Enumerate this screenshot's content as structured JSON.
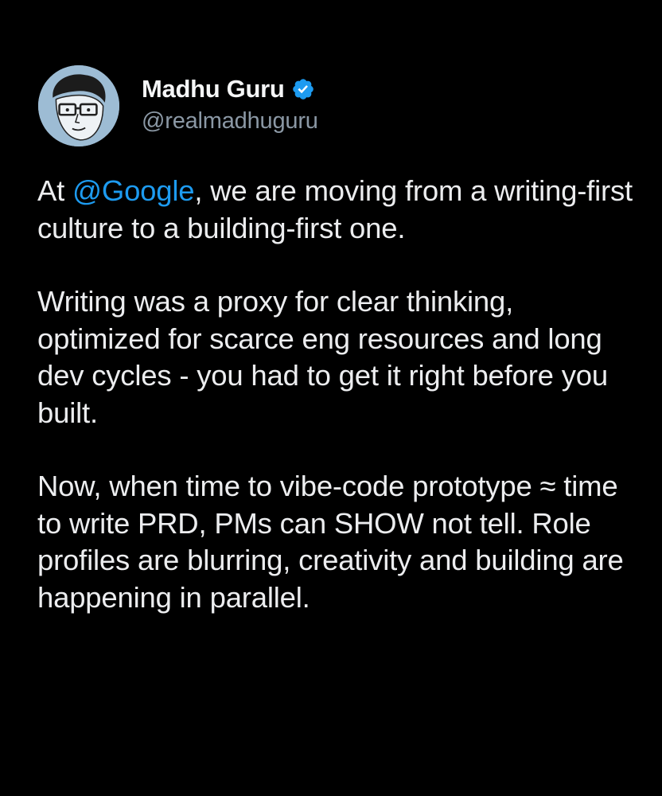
{
  "tweet": {
    "author": {
      "display_name": "Madhu Guru",
      "handle": "@realmadhuguru",
      "verified": true,
      "verified_icon": "verified-badge-icon",
      "avatar": "cartoon-avatar-with-glasses"
    },
    "paragraphs": [
      {
        "before": "At ",
        "mention": "@Google",
        "after": ", we are moving from a writing-first culture to a building-first one."
      },
      {
        "text": "Writing was a proxy for clear thinking, optimized for scarce eng resources and long dev cycles - you had to get it right before you built."
      },
      {
        "text": "Now, when time to vibe-code prototype ≈ time to write PRD, PMs can SHOW not tell. Role profiles are blurring, creativity and building are happening in parallel."
      }
    ]
  },
  "colors": {
    "background": "#000000",
    "text": "#ECEDEF",
    "handle": "#8B98A5",
    "mention": "#1D9BF0",
    "verified": "#1D9BF0"
  }
}
